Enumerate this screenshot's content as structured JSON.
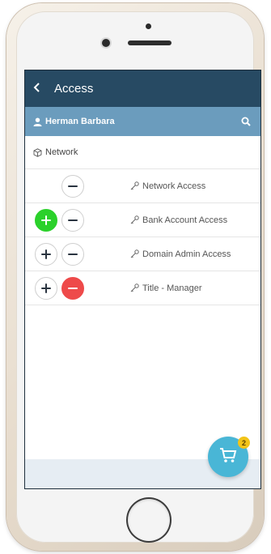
{
  "header": {
    "back_icon": "chevron-left-icon",
    "title": "Access"
  },
  "user": {
    "name": "Herman Barbara",
    "user_icon": "user-icon",
    "search_icon": "search-icon"
  },
  "section": {
    "label": "Network",
    "icon": "cube-icon"
  },
  "access_rows": [
    {
      "label": "Network Access",
      "show_add": false,
      "add_active": false,
      "remove_active": false
    },
    {
      "label": "Bank Account Access",
      "show_add": true,
      "add_active": true,
      "remove_active": false
    },
    {
      "label": "Domain Admin Access",
      "show_add": true,
      "add_active": false,
      "remove_active": false
    },
    {
      "label": "Title - Manager",
      "show_add": true,
      "add_active": false,
      "remove_active": true
    }
  ],
  "cart": {
    "count": "2",
    "icon": "cart-icon"
  },
  "colors": {
    "header_bg": "#274a63",
    "subheader_bg": "#6b9cbd",
    "add_active": "#2bd12b",
    "remove_active": "#ee4a4a",
    "cart_bg": "#49b6d6",
    "badge_bg": "#f2c418"
  }
}
